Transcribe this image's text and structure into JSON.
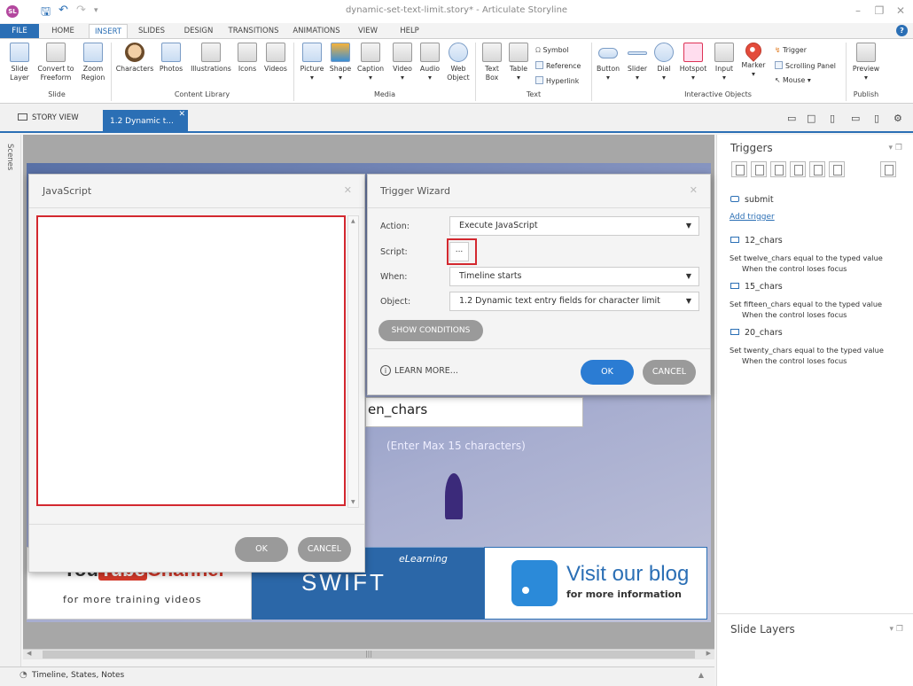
{
  "window": {
    "title": "dynamic-set-text-limit.story* - Articulate Storyline",
    "app_logo": "SL"
  },
  "ribbon_tabs": [
    {
      "label": "FILE"
    },
    {
      "label": "HOME"
    },
    {
      "label": "INSERT"
    },
    {
      "label": "SLIDES"
    },
    {
      "label": "DESIGN"
    },
    {
      "label": "TRANSITIONS"
    },
    {
      "label": "ANIMATIONS"
    },
    {
      "label": "VIEW"
    },
    {
      "label": "HELP"
    }
  ],
  "ribbon": {
    "slide_layer": "Slide Layer",
    "convert_freeform": "Convert to Freeform",
    "zoom_region": "Zoom Region",
    "group_slide": "Slide",
    "characters": "Characters",
    "photos": "Photos",
    "illustrations": "Illustrations",
    "icons": "Icons",
    "videos": "Videos",
    "group_content_library": "Content Library",
    "picture": "Picture",
    "shape": "Shape",
    "caption": "Caption",
    "video": "Video",
    "audio": "Audio",
    "web_object": "Web Object",
    "group_media": "Media",
    "text_box": "Text Box",
    "table": "Table",
    "symbol": "Symbol",
    "reference": "Reference",
    "hyperlink": "Hyperlink",
    "group_text": "Text",
    "button": "Button",
    "slider": "Slider",
    "dial": "Dial",
    "hotspot": "Hotspot",
    "input": "Input",
    "marker": "Marker",
    "trigger": "Trigger",
    "scrolling_panel": "Scrolling Panel",
    "mouse": "Mouse",
    "group_interactive": "Interactive Objects",
    "preview": "Preview",
    "group_publish": "Publish"
  },
  "story_tabs": {
    "story_view": "STORY VIEW",
    "slide_tab": "1.2 Dynamic t..."
  },
  "scenes_label": "Scenes",
  "slide_content": {
    "entry_text": "en_chars",
    "entry_hint": "(Enter Max 15 characters)",
    "yt_you": "You",
    "yt_tube": "Tube",
    "yt_channel": "Channel",
    "yt_sub": "for more training videos",
    "swift_el": "eLearning",
    "swift_brand": "SWIFT",
    "blog_big": "Visit our blog",
    "blog_small": "for more information"
  },
  "js_dialog": {
    "title": "JavaScript",
    "code": "",
    "ok": "OK",
    "cancel": "CANCEL"
  },
  "trigger_wizard": {
    "title": "Trigger Wizard",
    "action_label": "Action:",
    "action_value": "Execute JavaScript",
    "script_label": "Script:",
    "script_button": "...",
    "when_label": "When:",
    "when_value": "Timeline starts",
    "object_label": "Object:",
    "object_value": "1.2 Dynamic text entry fields for character limit",
    "show_conditions": "SHOW CONDITIONS",
    "learn_more": "LEARN MORE...",
    "ok": "OK",
    "cancel": "CANCEL"
  },
  "triggers_panel": {
    "title": "Triggers",
    "submit": "submit",
    "add_trigger": "Add trigger",
    "items": [
      {
        "name": "12_chars",
        "desc": "Set twelve_chars equal to the typed value",
        "when": "When the control loses focus"
      },
      {
        "name": "15_chars",
        "desc": "Set fifteen_chars equal to the typed value",
        "when": "When the control loses focus"
      },
      {
        "name": "20_chars",
        "desc": "Set twenty_chars equal to the typed value",
        "when": "When the control loses focus"
      }
    ]
  },
  "slide_layers_panel": {
    "title": "Slide Layers"
  },
  "status_bar": {
    "label": "Timeline, States, Notes"
  }
}
